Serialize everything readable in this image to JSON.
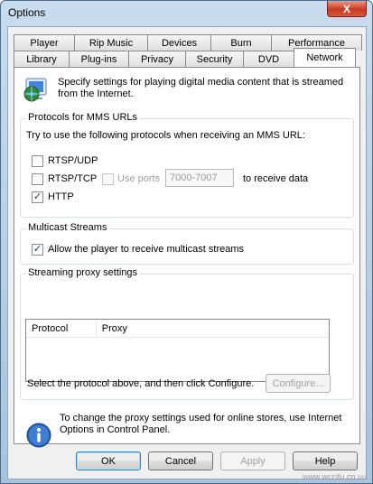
{
  "window": {
    "title": "Options",
    "close_glyph": "X"
  },
  "tabs_top": [
    {
      "label": "Player"
    },
    {
      "label": "Rip Music"
    },
    {
      "label": "Devices"
    },
    {
      "label": "Burn"
    },
    {
      "label": "Performance"
    }
  ],
  "tabs_bottom": [
    {
      "label": "Library"
    },
    {
      "label": "Plug-ins"
    },
    {
      "label": "Privacy"
    },
    {
      "label": "Security"
    },
    {
      "label": "DVD"
    },
    {
      "label": "Network",
      "active": true
    }
  ],
  "intro": {
    "icon": "network-globe-icon",
    "text": "Specify settings for playing digital media content that is streamed from the Internet."
  },
  "protocols": {
    "group_label": "Protocols for MMS URLs",
    "instruction": "Try to use the following protocols when receiving an MMS URL:",
    "rtsp_udp": {
      "label": "RTSP/UDP",
      "checked": false
    },
    "rtsp_tcp": {
      "label": "RTSP/TCP",
      "checked": false
    },
    "use_ports": {
      "label": "Use ports",
      "checked": false,
      "enabled": false
    },
    "ports_value": "7000-7007",
    "ports_suffix": "to receive data",
    "http": {
      "label": "HTTP",
      "checked": true
    }
  },
  "multicast": {
    "group_label": "Multicast Streams",
    "allow": {
      "label": "Allow the player to receive multicast streams",
      "checked": true
    }
  },
  "proxy": {
    "group_label": "Streaming proxy settings",
    "columns": [
      "Protocol",
      "Proxy"
    ],
    "hint": "Select the protocol above, and then click Configure.",
    "configure_label": "Configure..."
  },
  "info": {
    "icon": "info-icon",
    "text": "To change the proxy settings used for online stores, use Internet Options in Control Panel."
  },
  "buttons": {
    "ok": "OK",
    "cancel": "Cancel",
    "apply": "Apply",
    "help": "Help"
  },
  "watermark": "www.wccitu.co.uu",
  "colors": {
    "accent": "#1f3f7a",
    "titlebar": "#c9dcee",
    "close": "#c43a20"
  }
}
